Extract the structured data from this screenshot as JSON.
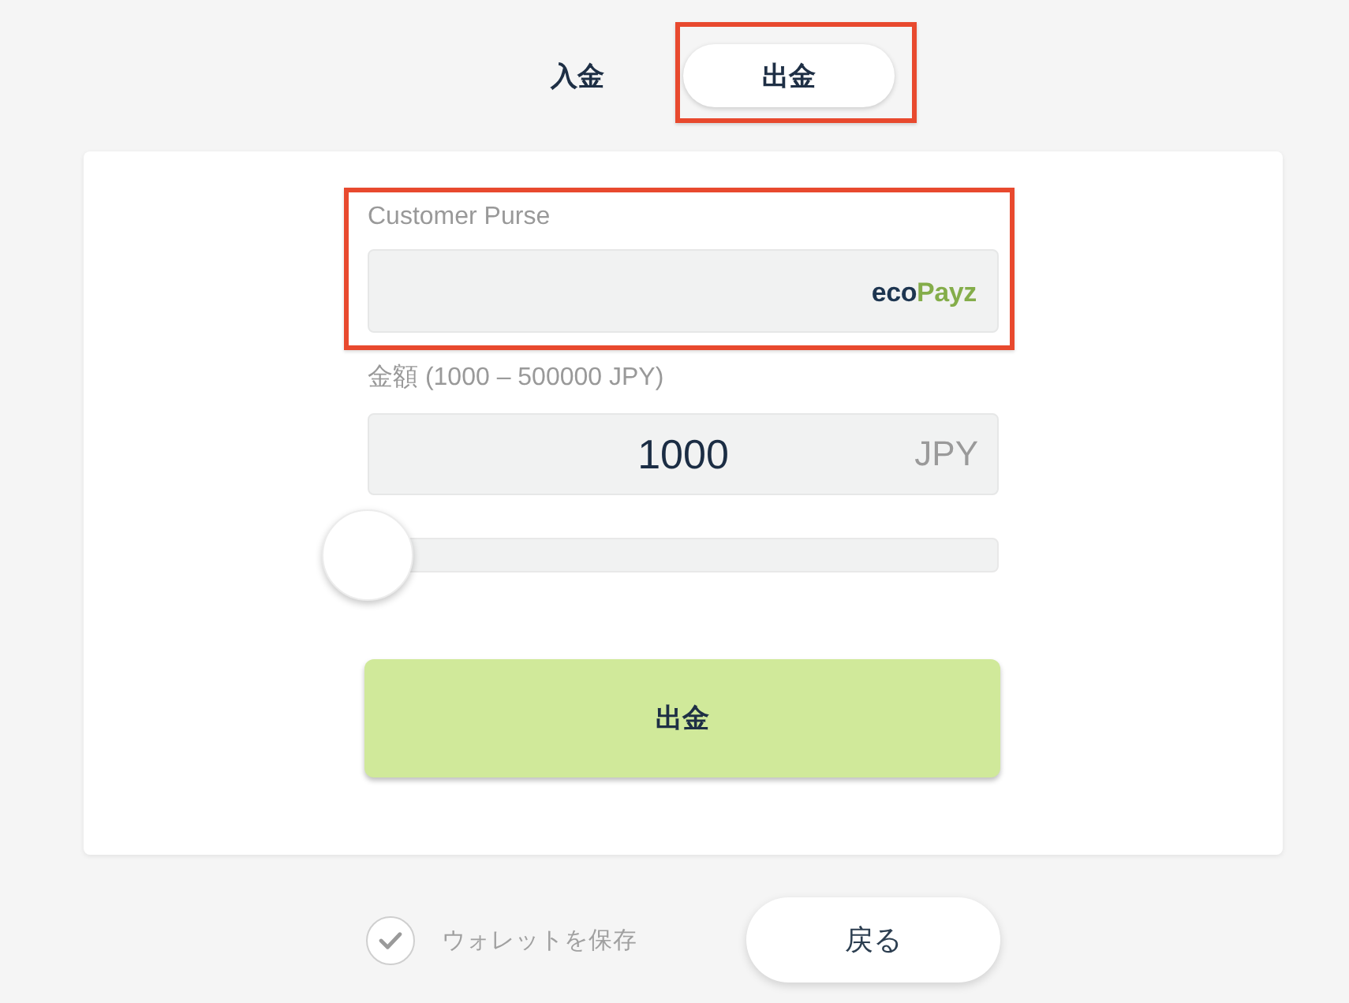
{
  "tabs": [
    {
      "label": "入金",
      "selected": false,
      "highlighted": false
    },
    {
      "label": "出金",
      "selected": true,
      "highlighted": true
    }
  ],
  "form": {
    "purse": {
      "label": "Customer Purse",
      "highlighted": true,
      "logo": "ecoPayz"
    },
    "amount": {
      "label": "金額 (1000 – 500000 JPY)",
      "value": "1000",
      "currency": "JPY"
    },
    "slider": {
      "level": 0
    },
    "submit": {
      "label": "出金"
    }
  },
  "footer": {
    "save_wallet": {
      "label": "ウォレットを保存",
      "checked": true
    },
    "back": {
      "label": "戻る"
    }
  }
}
